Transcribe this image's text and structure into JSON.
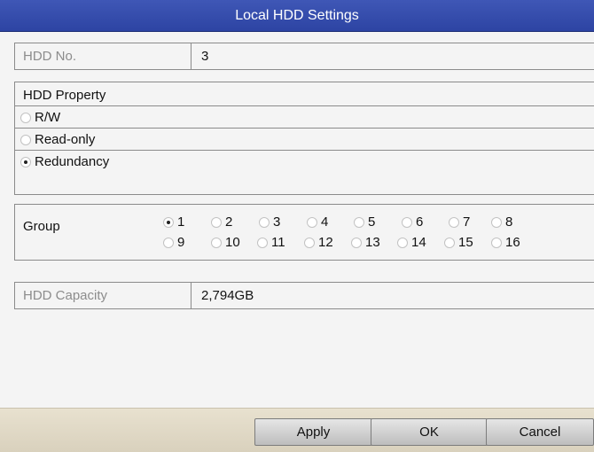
{
  "window": {
    "title": "Local HDD Settings"
  },
  "hdd_no": {
    "label": "HDD No.",
    "value": "3"
  },
  "hdd_property": {
    "heading": "HDD Property",
    "options": [
      {
        "label": "R/W",
        "selected": false
      },
      {
        "label": "Read-only",
        "selected": false
      },
      {
        "label": "Redundancy",
        "selected": true
      }
    ]
  },
  "group": {
    "label": "Group",
    "options": [
      "1",
      "2",
      "3",
      "4",
      "5",
      "6",
      "7",
      "8",
      "9",
      "10",
      "11",
      "12",
      "13",
      "14",
      "15",
      "16"
    ],
    "selected": "1"
  },
  "hdd_capacity": {
    "label": "HDD Capacity",
    "value": "2,794GB"
  },
  "buttons": {
    "apply": "Apply",
    "ok": "OK",
    "cancel": "Cancel"
  },
  "colors": {
    "titlebar": "#3249ab",
    "footer": "#ddd5c2",
    "panel": "#f4f4f4"
  }
}
